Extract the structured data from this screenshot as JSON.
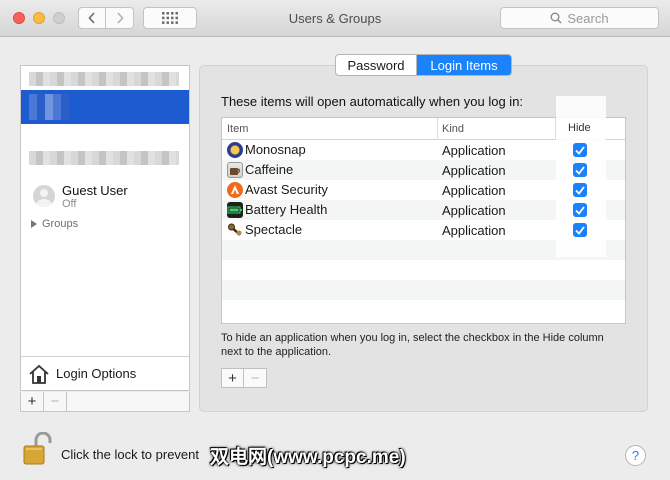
{
  "window": {
    "title": "Users & Groups"
  },
  "search": {
    "placeholder": "Search",
    "icon": "search-icon"
  },
  "sidebar": {
    "guest_user": {
      "name": "Guest User",
      "status": "Off"
    },
    "groups_label": "Groups",
    "login_options_label": "Login Options",
    "add_label": "+",
    "remove_label": "−"
  },
  "tabs": [
    {
      "label": "Password",
      "selected": false
    },
    {
      "label": "Login Items",
      "selected": true
    }
  ],
  "login_items": {
    "intro": "These items will open automatically when you log in:",
    "columns": {
      "item": "Item",
      "kind": "Kind",
      "hide": "Hide"
    },
    "rows": [
      {
        "name": "Monosnap",
        "kind": "Application",
        "hide": true,
        "icon": "monosnap-icon"
      },
      {
        "name": "Caffeine",
        "kind": "Application",
        "hide": true,
        "icon": "caffeine-icon"
      },
      {
        "name": "Avast Security",
        "kind": "Application",
        "hide": true,
        "icon": "avast-icon"
      },
      {
        "name": "Battery Health",
        "kind": "Application",
        "hide": true,
        "icon": "battery-health-icon"
      },
      {
        "name": "Spectacle",
        "kind": "Application",
        "hide": true,
        "icon": "spectacle-icon"
      }
    ],
    "help_text": "To hide an application when you log in, select the checkbox in the Hide column next to the application.",
    "add_label": "+",
    "remove_label": "−"
  },
  "footer": {
    "lock_text": "Click the lock to prevent",
    "watermark": "双电网(www.pcpc.me)",
    "help_label": "?"
  },
  "colors": {
    "accent": "#1a82fb",
    "selection": "#1d5bd1"
  }
}
